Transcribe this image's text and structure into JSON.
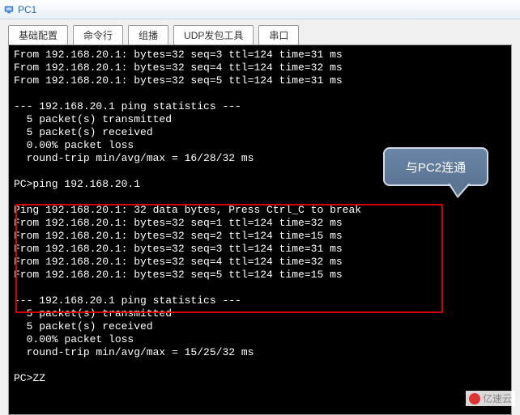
{
  "window": {
    "title": "PC1"
  },
  "tabs": [
    {
      "label": "基础配置"
    },
    {
      "label": "命令行"
    },
    {
      "label": "组播"
    },
    {
      "label": "UDP发包工具"
    },
    {
      "label": "串口"
    }
  ],
  "callout": {
    "text": "与PC2连通"
  },
  "terminal": {
    "block1": [
      "From 192.168.20.1: bytes=32 seq=3 ttl=124 time=31 ms",
      "From 192.168.20.1: bytes=32 seq=4 ttl=124 time=32 ms",
      "From 192.168.20.1: bytes=32 seq=5 ttl=124 time=31 ms",
      "",
      "--- 192.168.20.1 ping statistics ---",
      "  5 packet(s) transmitted",
      "  5 packet(s) received",
      "  0.00% packet loss",
      "  round-trip min/avg/max = 16/28/32 ms",
      ""
    ],
    "prompt1": "PC>ping 192.168.20.1",
    "block2": [
      "",
      "Ping 192.168.20.1: 32 data bytes, Press Ctrl_C to break",
      "From 192.168.20.1: bytes=32 seq=1 ttl=124 time=32 ms",
      "From 192.168.20.1: bytes=32 seq=2 ttl=124 time=15 ms",
      "From 192.168.20.1: bytes=32 seq=3 ttl=124 time=31 ms",
      "From 192.168.20.1: bytes=32 seq=4 ttl=124 time=32 ms",
      "From 192.168.20.1: bytes=32 seq=5 ttl=124 time=15 ms",
      "",
      "--- 192.168.20.1 ping statistics ---",
      "  5 packet(s) transmitted",
      "  5 packet(s) received",
      "  0.00% packet loss",
      "  round-trip min/avg/max = 15/25/32 ms",
      ""
    ],
    "prompt2": "PC>ZZ"
  },
  "watermark": {
    "text": "亿速云"
  }
}
